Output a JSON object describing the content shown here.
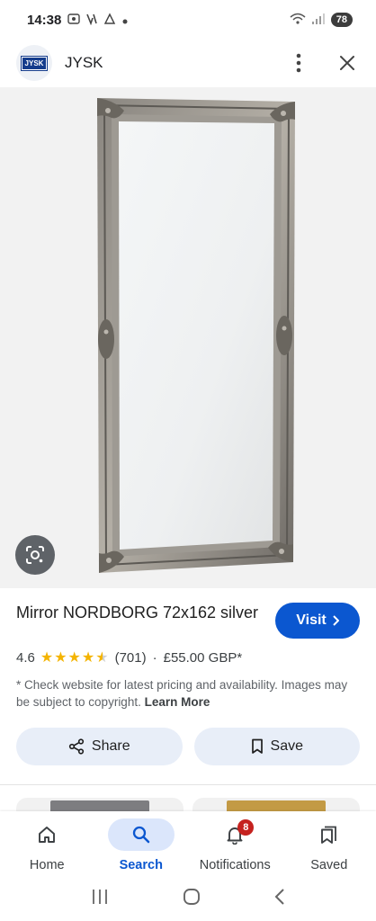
{
  "status_bar": {
    "time": "14:38",
    "left_icons": [
      "screenshot-icon",
      "volte-icon",
      "android-auto-icon",
      "dot-icon"
    ],
    "battery": "78"
  },
  "header": {
    "logo_text": "JYSK",
    "site_name": "JYSK"
  },
  "product": {
    "title": "Mirror NORDBORG 72x162 silver",
    "visit_label": "Visit",
    "rating": "4.6",
    "rating_value": 4.6,
    "review_count": "(701)",
    "separator": "·",
    "price": "£55.00 GBP*",
    "disclaimer": "* Check website for latest pricing and availability. Images may be subject to copyright.",
    "learn_more": "Learn More"
  },
  "actions": {
    "share_label": "Share",
    "save_label": "Save"
  },
  "thumbnails": [
    {
      "frame_color": "#7d7d80"
    },
    {
      "frame_color": "#c39a45"
    }
  ],
  "bottom_nav": {
    "items": [
      {
        "label": "Home",
        "icon": "home-icon",
        "active": false
      },
      {
        "label": "Search",
        "icon": "search-icon",
        "active": true
      },
      {
        "label": "Notifications",
        "icon": "bell-icon",
        "active": false,
        "badge": "8"
      },
      {
        "label": "Saved",
        "icon": "bookmarks-icon",
        "active": false
      }
    ]
  },
  "colors": {
    "accent": "#0b57d0",
    "pill_bg": "#e8eef8",
    "badge": "#c5221f",
    "star": "#f4b400"
  }
}
